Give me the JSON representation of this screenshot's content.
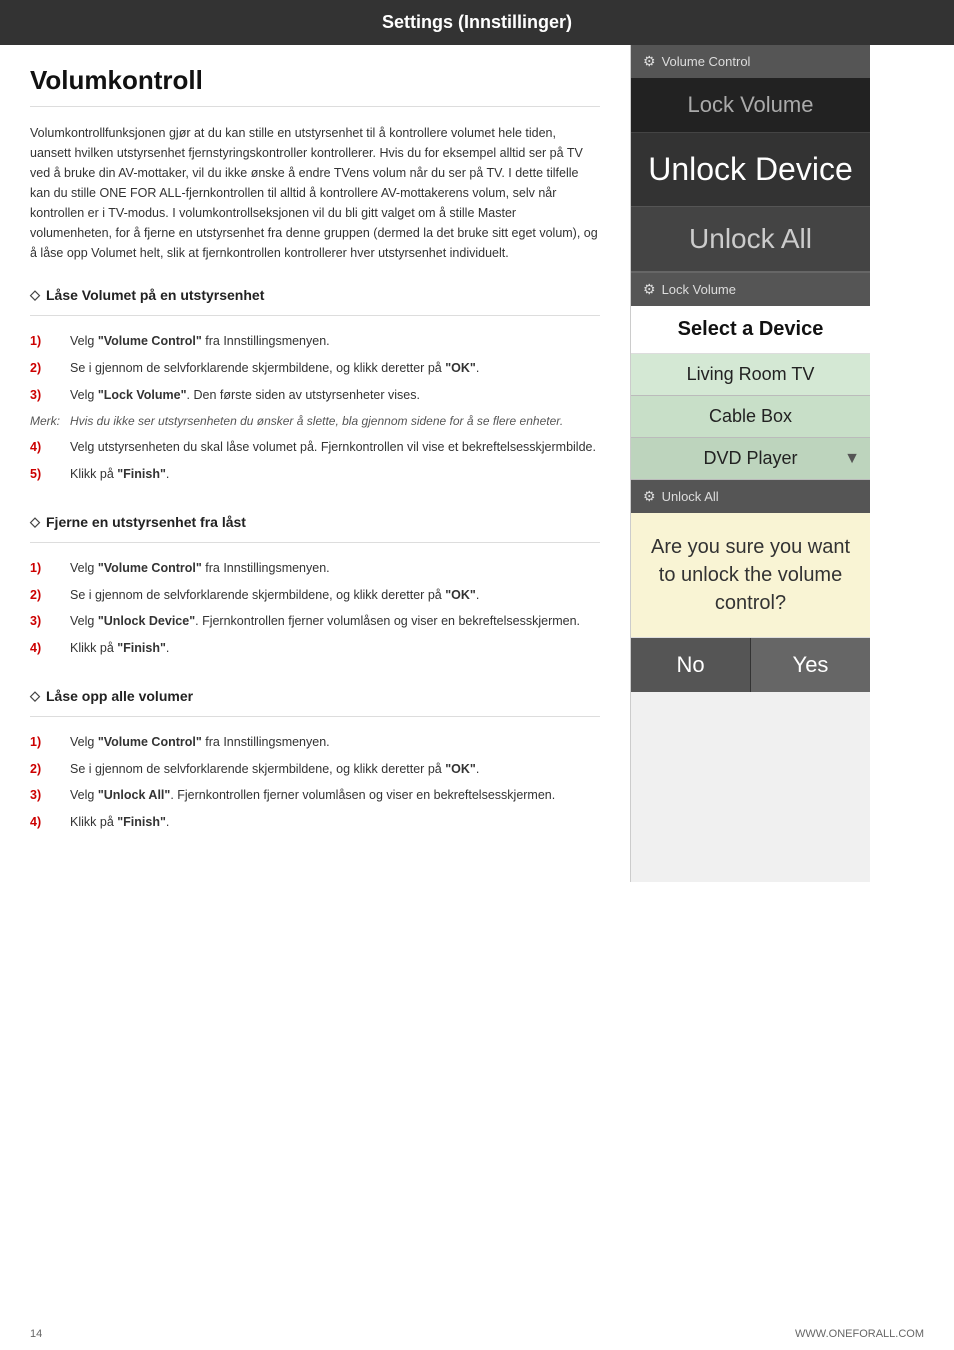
{
  "header": {
    "title": "Settings (Innstillinger)"
  },
  "main": {
    "title": "Volumkontroll",
    "intro": "Volumkontrollfunksjonen gjør at du kan stille en utstyrsenhet til å kontrollere volumet hele tiden, uansett hvilken utstyrsenhet fjernstyringskontroller kontrollerer. Hvis du for eksempel alltid ser på TV ved å bruke din AV-mottaker, vil du ikke ønske å endre TVens volum når du ser på TV. I dette tilfelle kan du stille ONE FOR ALL-fjernkontrollen til alltid å kontrollere AV-mottakerens volum, selv når kontrollen er i TV-modus. I volumkontrollseksjonen vil du bli gitt valget om å stille Master volumenheten, for å fjerne en utstyrsenhet fra denne gruppen (dermed la det bruke sitt eget volum), og å låse opp Volumet helt, slik at fjernkontrollen kontrollerer hver utstyrsenhet individuelt.",
    "section1": {
      "title": "Låse Volumet på en utstyrsenhet",
      "steps": [
        {
          "num": "1)",
          "text": "Velg \"Volume Control\" fra Innstillingsmenyen.",
          "bold_parts": [
            "\"Volume Control\""
          ]
        },
        {
          "num": "2)",
          "text": "Se i gjennom de selvforklarende skjermbildene, og klikk deretter på \"OK\".",
          "bold_parts": [
            "\"OK\""
          ]
        },
        {
          "num": "3)",
          "text": "Velg \"Lock Volume\". Den første siden av utstyrsenheter vises.",
          "bold_parts": [
            "\"Lock Volume\""
          ]
        },
        {
          "num": "Merk:",
          "text": "Hvis du ikke ser utstyrsenheten du ønsker å slette, bla gjennom sidene for å se flere enheter.",
          "italic": true
        },
        {
          "num": "4)",
          "text": "Velg utstyrsenheten du skal låse volumet på. Fjernkontrollen vil vise et bekreftelsesskjermbilde."
        },
        {
          "num": "5)",
          "text": "Klikk på \"Finish\".",
          "bold_parts": [
            "\"Finish\""
          ]
        }
      ]
    },
    "section2": {
      "title": "Fjerne en utstyrsenhet fra låst",
      "steps": [
        {
          "num": "1)",
          "text": "Velg \"Volume Control\" fra Innstillingsmenyen.",
          "bold_parts": [
            "\"Volume Control\""
          ]
        },
        {
          "num": "2)",
          "text": "Se i gjennom de selvforklarende skjermbildene, og klikk deretter på \"OK\".",
          "bold_parts": [
            "\"OK\""
          ]
        },
        {
          "num": "3)",
          "text": "Velg \"Unlock Device\". Fjernkontrollen fjerner volumlåsen og viser en bekreftelsesskjermen.",
          "bold_parts": [
            "\"Unlock Device\""
          ]
        },
        {
          "num": "4)",
          "text": "Klikk på \"Finish\".",
          "bold_parts": [
            "\"Finish\""
          ]
        }
      ]
    },
    "section3": {
      "title": "Låse opp alle volumer",
      "steps": [
        {
          "num": "1)",
          "text": "Velg \"Volume Control\" fra Innstillingsmenyen.",
          "bold_parts": [
            "\"Volume Control\""
          ]
        },
        {
          "num": "2)",
          "text": "Se i gjennom de selvforklarende skjermbildene, og klikk deretter på \"OK\".",
          "bold_parts": [
            "\"OK\""
          ]
        },
        {
          "num": "3)",
          "text": "Velg \"Unlock All\". Fjernkontrollen fjerner volumlåsen og viser en bekreftelsesskjermen.",
          "bold_parts": [
            "\"Unlock All\""
          ]
        },
        {
          "num": "4)",
          "text": "Klikk på \"Finish\".",
          "bold_parts": [
            "\"Finish\""
          ]
        }
      ]
    }
  },
  "panel": {
    "header1": "Volume Control",
    "lock_volume": "Lock Volume",
    "unlock_device": "Unlock Device",
    "unlock_all_top": "Unlock All",
    "header2": "Lock Volume",
    "select_device": "Select a Device",
    "device1": "Living Room TV",
    "device2": "Cable Box",
    "device3": "DVD Player",
    "header3": "Unlock All",
    "confirm_text": "Are you sure you want to unlock the volume control?",
    "btn_no": "No",
    "btn_yes": "Yes"
  },
  "footer": {
    "page_num": "14",
    "website": "WWW.ONEFORALL.COM"
  }
}
